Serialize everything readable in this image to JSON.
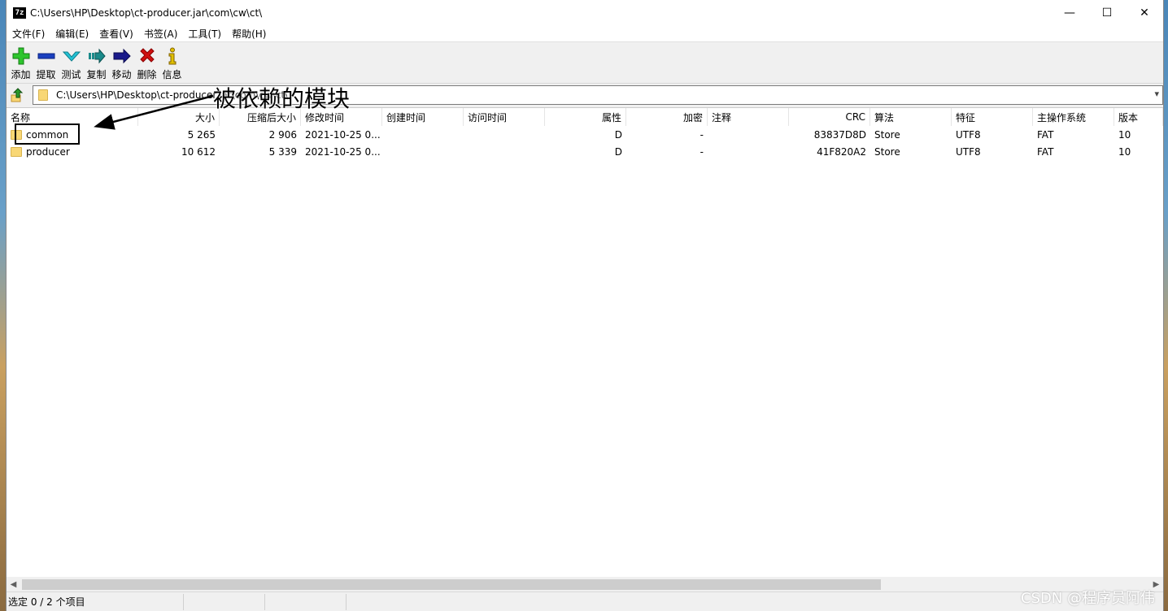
{
  "window": {
    "title": "C:\\Users\\HP\\Desktop\\ct-producer.jar\\com\\cw\\ct\\",
    "app_icon_text": "7z",
    "controls": {
      "minimize": "—",
      "maximize": "☐",
      "close": "✕"
    }
  },
  "menu": [
    "文件(F)",
    "编辑(E)",
    "查看(V)",
    "书签(A)",
    "工具(T)",
    "帮助(H)"
  ],
  "toolbar": [
    {
      "label": "添加",
      "icon": "add-icon",
      "color": "#22aa22"
    },
    {
      "label": "提取",
      "icon": "extract-icon",
      "color": "#1a3fbf"
    },
    {
      "label": "测试",
      "icon": "test-icon",
      "color": "#17a5b8"
    },
    {
      "label": "复制",
      "icon": "copy-icon",
      "color": "#1a8a8a"
    },
    {
      "label": "移动",
      "icon": "move-icon",
      "color": "#1a1a8a"
    },
    {
      "label": "删除",
      "icon": "delete-icon",
      "color": "#d01010"
    },
    {
      "label": "信息",
      "icon": "info-icon",
      "color": "#c8a800"
    }
  ],
  "address": {
    "path": "C:\\Users\\HP\\Desktop\\ct-producer.jar\\com\\cw\\ct\\"
  },
  "annotation": {
    "label": "被依赖的模块"
  },
  "columns": {
    "name": "名称",
    "size": "大小",
    "packed": "压缩后大小",
    "modified": "修改时间",
    "created": "创建时间",
    "accessed": "访问时间",
    "attributes": "属性",
    "encrypted": "加密",
    "comment": "注释",
    "crc": "CRC",
    "method": "算法",
    "characteristics": "特征",
    "host_os": "主操作系统",
    "version": "版本"
  },
  "rows": [
    {
      "name": "common",
      "size": "5 265",
      "packed": "2 906",
      "modified": "2021-10-25 0...",
      "created": "",
      "accessed": "",
      "attributes": "D",
      "encrypted": "-",
      "comment": "",
      "crc": "83837D8D",
      "method": "Store",
      "characteristics": "UTF8",
      "host_os": "FAT",
      "version": "10"
    },
    {
      "name": "producer",
      "size": "10 612",
      "packed": "5 339",
      "modified": "2021-10-25 0...",
      "created": "",
      "accessed": "",
      "attributes": "D",
      "encrypted": "-",
      "comment": "",
      "crc": "41F820A2",
      "method": "Store",
      "characteristics": "UTF8",
      "host_os": "FAT",
      "version": "10"
    }
  ],
  "status": {
    "selection": "选定 0 / 2 个项目"
  },
  "watermark": "CSDN @程序员阿伟"
}
